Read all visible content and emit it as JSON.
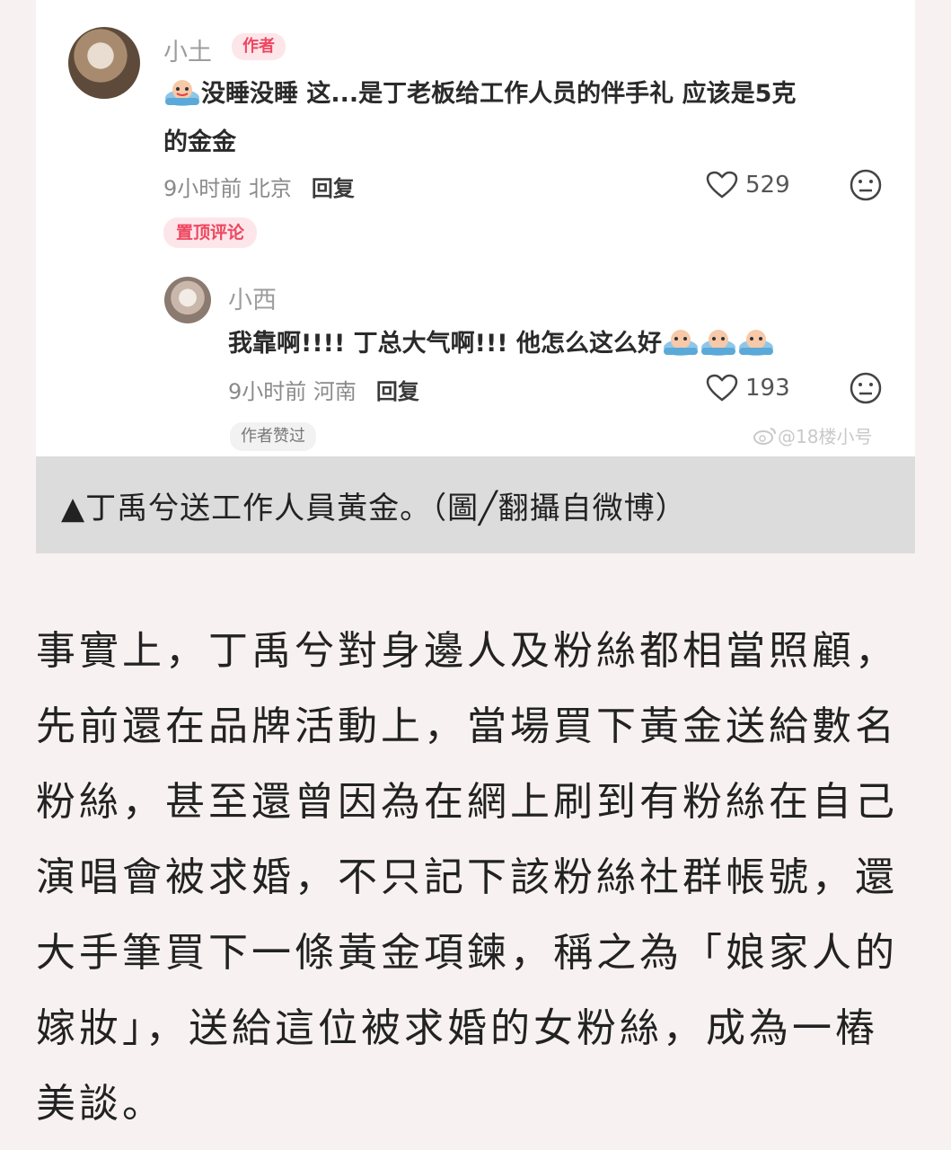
{
  "comment": {
    "username": "小土",
    "author_badge": "作者",
    "text_line1": "没睡没睡 这...是丁老板给工作人员的伴手礼 应该是5克",
    "text_line2": "的金金",
    "meta": "9小时前 北京",
    "reply_label": "回复",
    "likes": "529",
    "pinned_label": "置顶评论"
  },
  "reply": {
    "username": "小西",
    "text": "我靠啊!!!! 丁总大气啊!!! 他怎么这么好",
    "meta": "9小时前 河南",
    "reply_label": "回复",
    "likes": "193",
    "author_liked_label": "作者赞过"
  },
  "watermark": "@18楼小号",
  "caption": "▲丁禹兮送工作人員黃金。（圖╱翻攝自微博）",
  "article_lines": [
    "事實上，丁禹兮對身邊人及粉絲都相當照顧，",
    "先前還在品牌活動上，當場買下黃金送給數名",
    "粉絲，甚至還曾因為在網上刷到有粉絲在自己",
    "演唱會被求婚，不只記下該粉絲社群帳號，還",
    "大手筆買下一條黃金項鍊，稱之為「娘家人的",
    "嫁妝」，送給這位被求婚的女粉絲，成為一樁",
    "美談。"
  ],
  "icons": {
    "like": "heart-outline-icon",
    "react": "meh-face-icon",
    "emoji": "crying-bath-emoji-icon",
    "weibo": "weibo-logo-icon"
  },
  "colors": {
    "accent": "#ee4760",
    "badge_bg": "#fde6ea",
    "caption_bg": "#dcdcdc",
    "page_bg": "#f8f1f2"
  }
}
